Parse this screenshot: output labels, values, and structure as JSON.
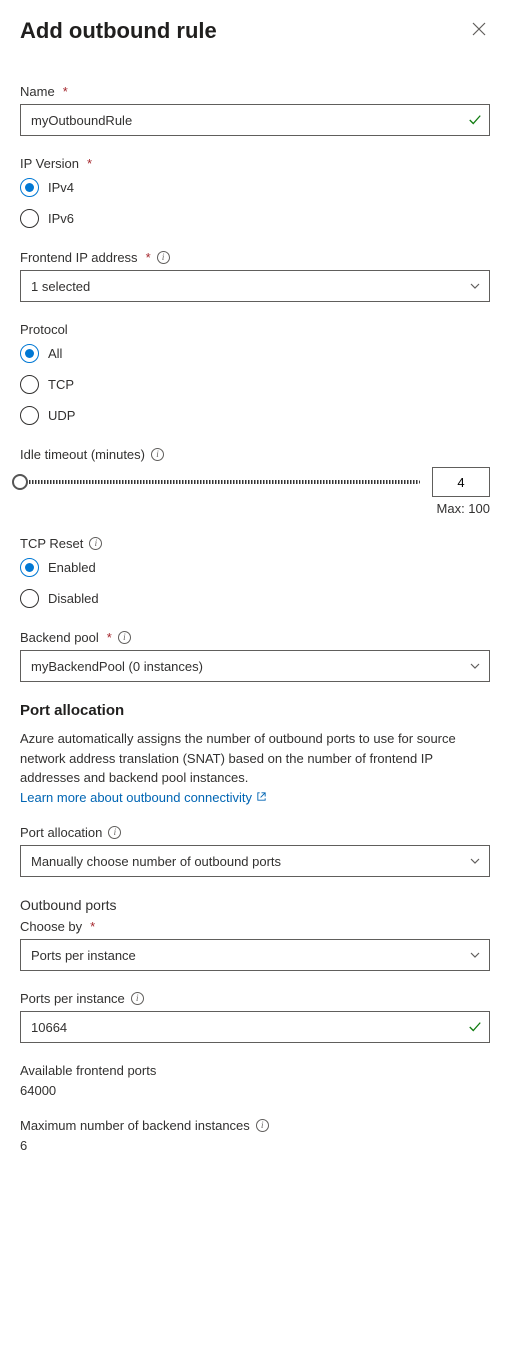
{
  "header": {
    "title": "Add outbound rule"
  },
  "name": {
    "label": "Name",
    "value": "myOutboundRule"
  },
  "ipVersion": {
    "label": "IP Version",
    "options": [
      "IPv4",
      "IPv6"
    ],
    "selected": "IPv4"
  },
  "frontendIp": {
    "label": "Frontend IP address",
    "value": "1 selected"
  },
  "protocol": {
    "label": "Protocol",
    "options": [
      "All",
      "TCP",
      "UDP"
    ],
    "selected": "All"
  },
  "idleTimeout": {
    "label": "Idle timeout (minutes)",
    "value": "4",
    "maxLabel": "Max: 100"
  },
  "tcpReset": {
    "label": "TCP Reset",
    "options": [
      "Enabled",
      "Disabled"
    ],
    "selected": "Enabled"
  },
  "backendPool": {
    "label": "Backend pool",
    "value": "myBackendPool (0 instances)"
  },
  "portAllocSection": {
    "heading": "Port allocation",
    "description": "Azure automatically assigns the number of outbound ports to use for source network address translation (SNAT) based on the number of frontend IP addresses and backend pool instances.",
    "linkText": "Learn more about outbound connectivity"
  },
  "portAllocation": {
    "label": "Port allocation",
    "value": "Manually choose number of outbound ports"
  },
  "outboundPorts": {
    "heading": "Outbound ports"
  },
  "chooseBy": {
    "label": "Choose by",
    "value": "Ports per instance"
  },
  "portsPerInstance": {
    "label": "Ports per instance",
    "value": "10664"
  },
  "availableFrontendPorts": {
    "label": "Available frontend ports",
    "value": "64000"
  },
  "maxBackendInstances": {
    "label": "Maximum number of backend instances",
    "value": "6"
  }
}
